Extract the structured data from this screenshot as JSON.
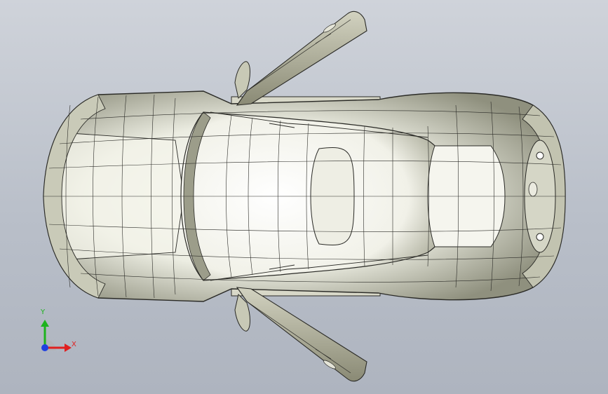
{
  "triad": {
    "y_label": "Y",
    "x_label": "X",
    "colors": {
      "y_axis": "#1db31d",
      "x_axis": "#e02020",
      "z_axis": "#2040e0"
    }
  },
  "colors": {
    "background_top": "#cfd3da",
    "background_bottom": "#aeb4bf",
    "body": "#e6e7da",
    "edge": "#2a2a26",
    "door": "#9a9a84"
  },
  "icons": [
    "coordinate-triad-icon"
  ]
}
